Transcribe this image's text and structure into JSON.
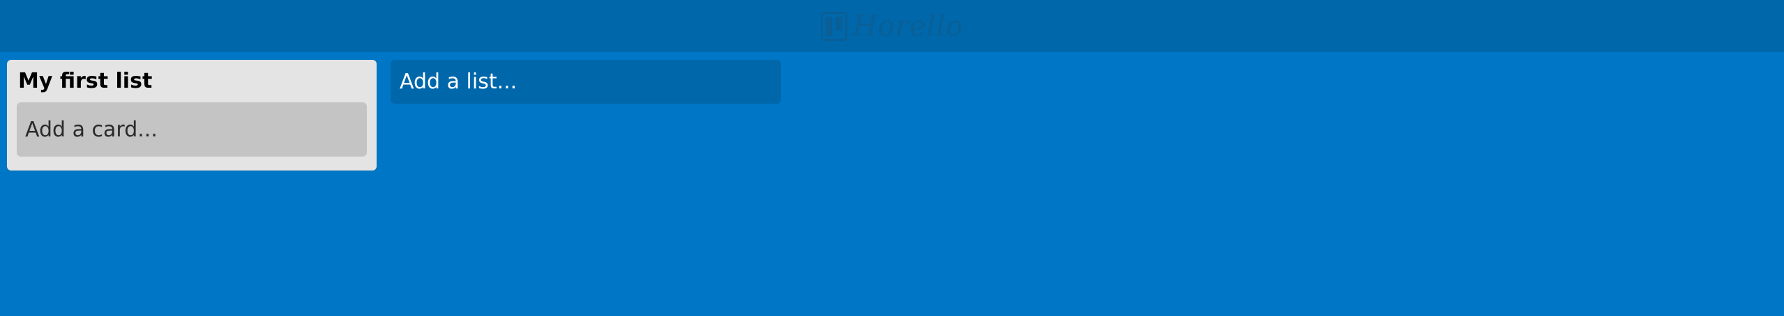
{
  "app": {
    "logo_text": "Horello",
    "logo_icon": "board-icon"
  },
  "lists": [
    {
      "title": "My first list",
      "add_card_label": "Add a card..."
    }
  ],
  "add_list_label": "Add a list...",
  "colors": {
    "background": "#0077c6",
    "header": "#0067ab",
    "logo": "#0a5f96",
    "list_bg": "#e4e4e4",
    "add_card_bg": "#c4c4c4",
    "add_list_bg": "#0067ab"
  }
}
